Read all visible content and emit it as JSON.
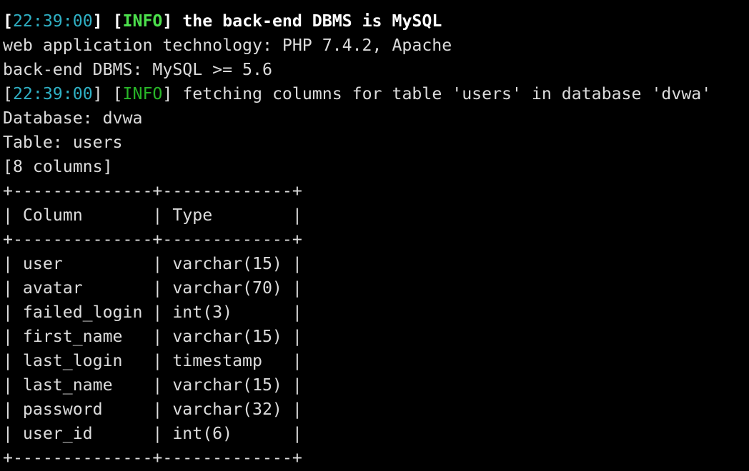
{
  "colors": {
    "background": "#000000",
    "text": "#dcdcdc",
    "timestamp": "#2fb0c4",
    "info_tag": "#28b628",
    "info_tag_bold": "#4ce04c"
  },
  "log": {
    "line1": {
      "time": "22:39:00",
      "level": "INFO",
      "message": " the back-end DBMS is MySQL"
    },
    "line2": "web application technology: PHP 7.4.2, Apache",
    "line3": "back-end DBMS: MySQL >= 5.6",
    "line4": {
      "time": "22:39:00",
      "level": "INFO",
      "message": " fetching columns for table 'users' in database 'dvwa'"
    },
    "database": "Database: dvwa",
    "table": "Table: users",
    "count": "[8 columns]"
  },
  "table": {
    "border": "+--------------+-------------+",
    "header": "| Column       | Type        |",
    "rows": [
      "| user         | varchar(15) |",
      "| avatar       | varchar(70) |",
      "| failed_login | int(3)      |",
      "| first_name   | varchar(15) |",
      "| last_login   | timestamp   |",
      "| last_name    | varchar(15) |",
      "| password     | varchar(32) |",
      "| user_id      | int(6)      |"
    ]
  }
}
